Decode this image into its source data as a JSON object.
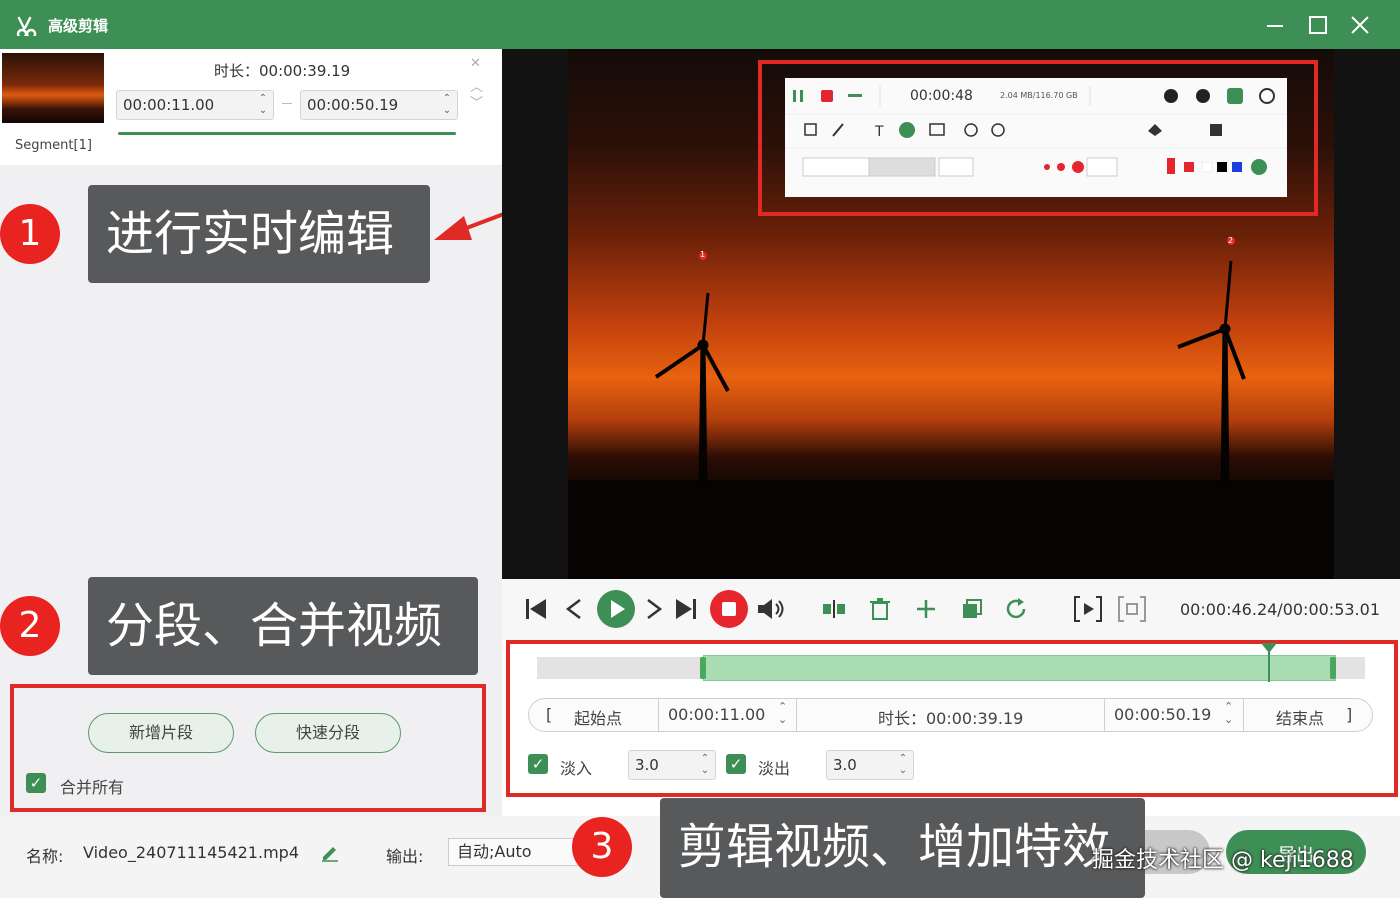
{
  "window": {
    "title": "高级剪辑",
    "controls": [
      "minimize-icon",
      "maximize-icon",
      "close-icon"
    ]
  },
  "segment": {
    "label": "Segment[1]",
    "duration_text": "时长：00:00:39.19",
    "start": "00:00:11.00",
    "end": "00:00:50.19"
  },
  "callouts": [
    {
      "num": "1",
      "text": "进行实时编辑"
    },
    {
      "num": "2",
      "text": "分段、合并视频"
    },
    {
      "num": "3",
      "text": "剪辑视频、增加特效"
    }
  ],
  "left_actions": {
    "new_segment": "新增片段",
    "quick_split": "快速分段",
    "merge_all": "合并所有"
  },
  "preview_toolbar": {
    "time": "00:00:48",
    "stats": "2.04 MB/116.70 GB"
  },
  "player": {
    "time_readout": "00:00:46.24/00:00:53.01",
    "markers": [
      "1",
      "2"
    ]
  },
  "range": {
    "start_label": "起始点",
    "start_value": "00:00:11.00",
    "duration": "时长：00:00:39.19",
    "end_value": "00:00:50.19",
    "end_label": "结束点",
    "open_bracket": "[",
    "close_bracket": "]"
  },
  "fades": {
    "fade_in_label": "淡入",
    "fade_in_value": "3.0",
    "fade_out_label": "淡出",
    "fade_out_value": "3.0"
  },
  "footer": {
    "name_label": "名称:",
    "filename": "Video_240711145421.mp4",
    "output_label": "输出:",
    "output_value": "自动;Auto",
    "export_label": "导出"
  },
  "watermark": "掘金技术社区 @ keji1688",
  "colors": {
    "brand": "#3d8f55",
    "callout_red": "#e9231f",
    "callout_bg": "#58595b"
  }
}
